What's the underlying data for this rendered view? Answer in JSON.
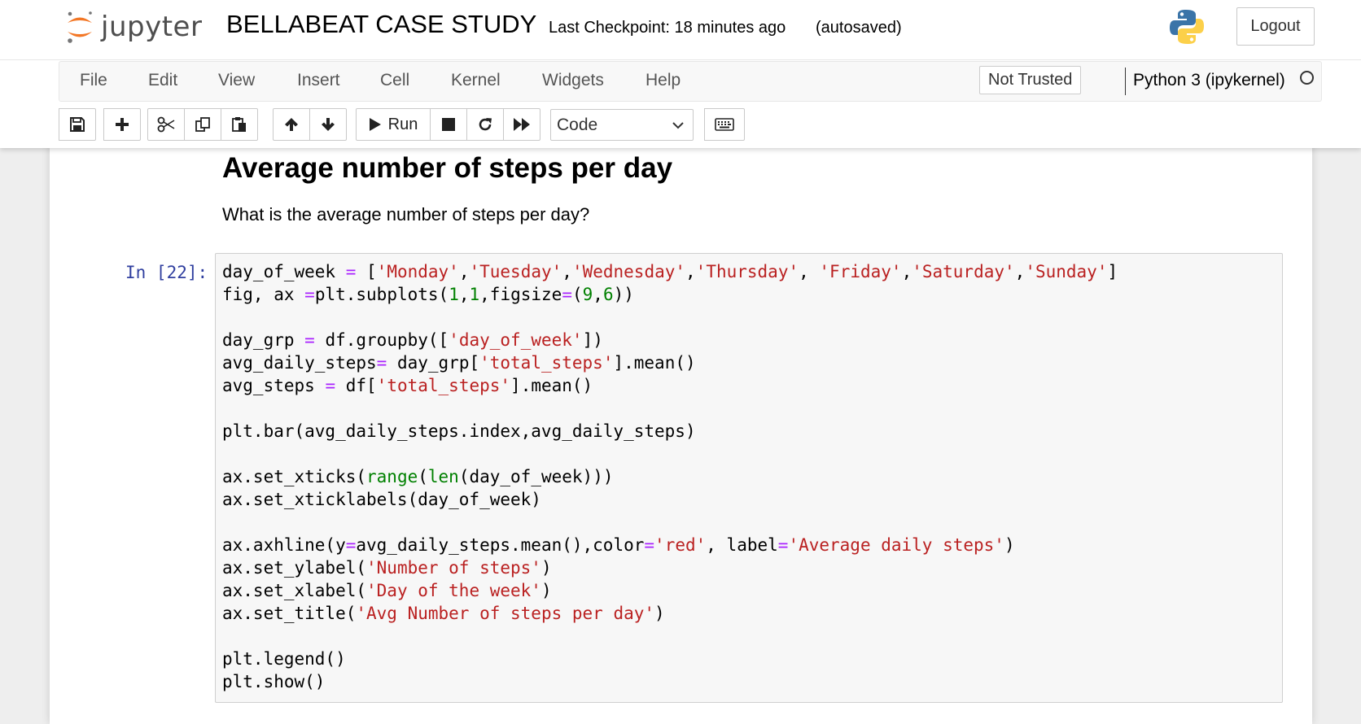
{
  "header": {
    "logo_text": "jupyter",
    "notebook_title": "BELLABEAT CASE STUDY",
    "checkpoint": "Last Checkpoint: 18 minutes ago",
    "autosave_status": "(autosaved)",
    "logout_label": "Logout"
  },
  "menubar": {
    "items": [
      "File",
      "Edit",
      "View",
      "Insert",
      "Cell",
      "Kernel",
      "Widgets",
      "Help"
    ],
    "trust_label": "Not Trusted",
    "kernel_name": "Python 3 (ipykernel)"
  },
  "toolbar": {
    "run_label": "Run",
    "cell_type": "Code",
    "icons": [
      "save-icon",
      "plus-icon",
      "cut-icon",
      "copy-icon",
      "paste-icon",
      "arrow-up-icon",
      "arrow-down-icon",
      "play-icon",
      "stop-icon",
      "restart-icon",
      "fast-forward-icon",
      "keyboard-icon"
    ]
  },
  "markdown_cell": {
    "heading": "Average number of steps per day",
    "text": "What is the average number of steps per day?"
  },
  "code_cell": {
    "prompt": "In [22]:",
    "lines": [
      [
        [
          "t",
          "day_of_week "
        ],
        [
          "o",
          "="
        ],
        [
          "t",
          " ["
        ],
        [
          "s",
          "'Monday'"
        ],
        [
          "t",
          ","
        ],
        [
          "s",
          "'Tuesday'"
        ],
        [
          "t",
          ","
        ],
        [
          "s",
          "'Wednesday'"
        ],
        [
          "t",
          ","
        ],
        [
          "s",
          "'Thursday'"
        ],
        [
          "t",
          ", "
        ],
        [
          "s",
          "'Friday'"
        ],
        [
          "t",
          ","
        ],
        [
          "s",
          "'Saturday'"
        ],
        [
          "t",
          ","
        ],
        [
          "s",
          "'Sunday'"
        ],
        [
          "t",
          "]"
        ]
      ],
      [
        [
          "t",
          "fig, ax "
        ],
        [
          "o",
          "="
        ],
        [
          "t",
          "plt.subplots("
        ],
        [
          "n",
          "1"
        ],
        [
          "t",
          ","
        ],
        [
          "n",
          "1"
        ],
        [
          "t",
          ",figsize"
        ],
        [
          "o",
          "="
        ],
        [
          "t",
          "("
        ],
        [
          "n",
          "9"
        ],
        [
          "t",
          ","
        ],
        [
          "n",
          "6"
        ],
        [
          "t",
          "))"
        ]
      ],
      [],
      [
        [
          "t",
          "day_grp "
        ],
        [
          "o",
          "="
        ],
        [
          "t",
          " df.groupby(["
        ],
        [
          "s",
          "'day_of_week'"
        ],
        [
          "t",
          "])"
        ]
      ],
      [
        [
          "t",
          "avg_daily_steps"
        ],
        [
          "o",
          "="
        ],
        [
          "t",
          " day_grp["
        ],
        [
          "s",
          "'total_steps'"
        ],
        [
          "t",
          "].mean()"
        ]
      ],
      [
        [
          "t",
          "avg_steps "
        ],
        [
          "o",
          "="
        ],
        [
          "t",
          " df["
        ],
        [
          "s",
          "'total_steps'"
        ],
        [
          "t",
          "].mean()"
        ]
      ],
      [],
      [
        [
          "t",
          "plt.bar(avg_daily_steps.index,avg_daily_steps)"
        ]
      ],
      [],
      [
        [
          "t",
          "ax.set_xticks("
        ],
        [
          "b",
          "range"
        ],
        [
          "t",
          "("
        ],
        [
          "b",
          "len"
        ],
        [
          "t",
          "(day_of_week)))"
        ]
      ],
      [
        [
          "t",
          "ax.set_xticklabels(day_of_week)"
        ]
      ],
      [],
      [
        [
          "t",
          "ax.axhline(y"
        ],
        [
          "o",
          "="
        ],
        [
          "t",
          "avg_daily_steps.mean(),color"
        ],
        [
          "o",
          "="
        ],
        [
          "s",
          "'red'"
        ],
        [
          "t",
          ", label"
        ],
        [
          "o",
          "="
        ],
        [
          "s",
          "'Average daily steps'"
        ],
        [
          "t",
          ")"
        ]
      ],
      [
        [
          "t",
          "ax.set_ylabel("
        ],
        [
          "s",
          "'Number of steps'"
        ],
        [
          "t",
          ")"
        ]
      ],
      [
        [
          "t",
          "ax.set_xlabel("
        ],
        [
          "s",
          "'Day of the week'"
        ],
        [
          "t",
          ")"
        ]
      ],
      [
        [
          "t",
          "ax.set_title("
        ],
        [
          "s",
          "'Avg Number of steps per day'"
        ],
        [
          "t",
          ")"
        ]
      ],
      [],
      [
        [
          "t",
          "plt.legend()"
        ]
      ],
      [
        [
          "t",
          "plt.show()"
        ]
      ]
    ]
  },
  "colors": {
    "string": "#ba2121",
    "number": "#008000",
    "operator": "#aa22ff",
    "builtin": "#008000",
    "prompt": "#303f9f",
    "logo_orange": "#f37726"
  }
}
